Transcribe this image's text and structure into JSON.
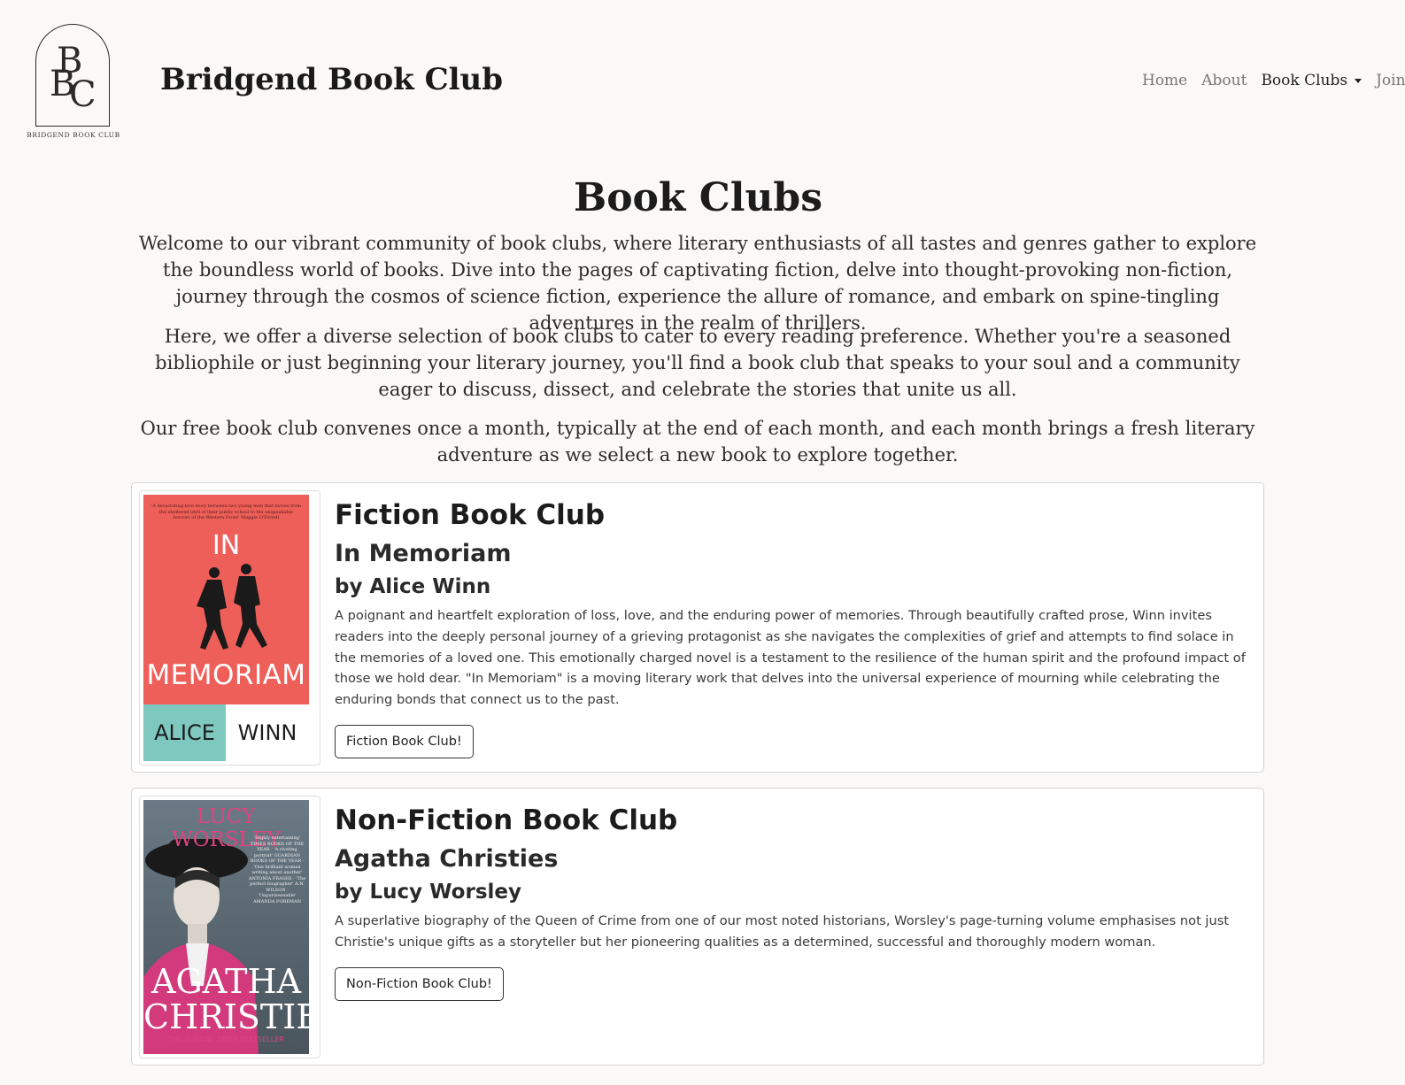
{
  "header": {
    "logo_letters": [
      "B",
      "B",
      "C"
    ],
    "logo_text": "BRIDGEND BOOK CLUB",
    "site_title": "Bridgend Book Club"
  },
  "nav": {
    "items": [
      {
        "label": "Home"
      },
      {
        "label": "About"
      },
      {
        "label": "Book Clubs"
      },
      {
        "label": "Join U"
      }
    ]
  },
  "page": {
    "title": "Book Clubs",
    "intro": [
      "Welcome to our vibrant community of book clubs, where literary enthusiasts of all tastes and genres gather to explore the boundless world of books. Dive into the pages of captivating fiction, delve into thought-provoking non-fiction, journey through the cosmos of science fiction, experience the allure of romance, and embark on spine-tingling adventures in the realm of thrillers.",
      "Here, we offer a diverse selection of book clubs to cater to every reading preference. Whether you're a seasoned bibliophile or just beginning your literary journey, you'll find a book club that speaks to your soul and a community eager to discuss, dissect, and celebrate the stories that unite us all.",
      "Our free book club convenes once a month, typically at the end of each month, and each month brings a fresh literary adventure as we select a new book to explore together."
    ]
  },
  "clubs": [
    {
      "club_title": "Fiction Book Club",
      "book_title": "In Memoriam",
      "author": "by Alice Winn",
      "description": "A poignant and heartfelt exploration of loss, love, and the enduring power of memories. Through beautifully crafted prose, Winn invites readers into the deeply personal journey of a grieving protagonist as she navigates the complexities of grief and attempts to find solace in the memories of a loved one. This emotionally charged novel is a testament to the resilience of the human spirit and the profound impact of those we hold dear. \"In Memoriam\" is a moving literary work that delves into the universal experience of mourning while celebrating the enduring bonds that connect us to the past.",
      "button": "Fiction Book Club!",
      "cover": {
        "quote": "'A devastating love story between two young men that moves from the sheltered idyll of their public school to the unspeakable horrors of the Western Front' Maggie O'Farrell",
        "word1": "IN",
        "word2": "MEMORIAM",
        "author_first": "ALICE",
        "author_last": "WINN",
        "bg_color": "#ef5f59",
        "accent_color": "#7ec8c0"
      }
    },
    {
      "club_title": "Non-Fiction Book Club",
      "book_title": "Agatha Christies",
      "author": "by Lucy Worsley",
      "description": "A superlative biography of the Queen of Crime from one of our most noted historians, Worsley's page-turning volume emphasises not just Christie's unique gifts as a storyteller but her pioneering qualities as a determined, successful and thoroughly modern woman.",
      "button": "Non-Fiction Book Club!",
      "cover": {
        "author_name": "LUCY WORSLEY",
        "quotes": "'Highly entertaining' TIMES BOOKS OF THE YEAR · 'A riveting portrait' GUARDIAN BOOKS OF THE YEAR · 'One brilliant woman writing about another' ANTONIA FRASER · 'The perfect biographer' A.N. WILSON · 'Unputdownable' AMANDA FOREMAN",
        "title_line1": "AGATHA",
        "title_line2": "CHRISTIE",
        "tagline": "THE SUNDAY TIMES BESTSELLER",
        "accent_color": "#e0447f"
      }
    }
  ]
}
